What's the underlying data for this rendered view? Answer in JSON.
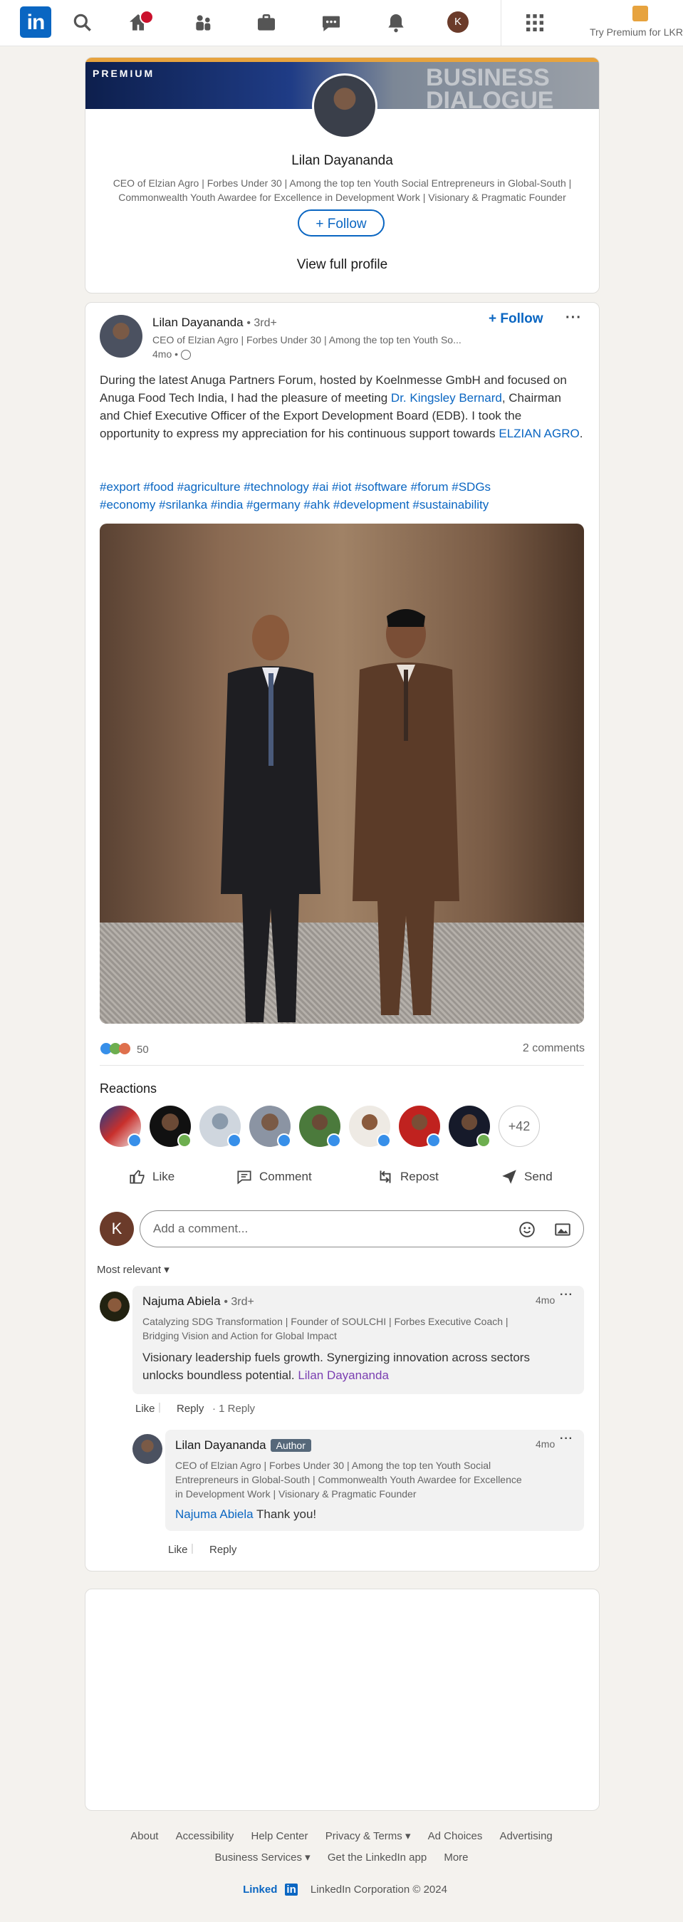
{
  "nav": {
    "logo": "in",
    "home_badge": "",
    "me_initial": "K",
    "premium_link": "Try Premium for LKR"
  },
  "profile_card": {
    "premium_label": "PREMIUM",
    "banner_text_1": "BUSINESS",
    "banner_text_2": "DIALOGUE",
    "name": "Lilan Dayananda",
    "headline": "CEO of Elzian Agro | Forbes Under 30 | Among the top ten Youth Social Entrepreneurs in Global-South | Commonwealth Youth Awardee for Excellence in Development Work | Visionary & Pragmatic Founder",
    "follow_label": "Follow",
    "view_profile_label": "View full profile"
  },
  "post": {
    "author": "Lilan Dayananda",
    "degree": "• 3rd+",
    "headline": "CEO of Elzian Agro | Forbes Under 30 | Among the top ten Youth So...",
    "time": "4mo •",
    "follow_label": "Follow",
    "text_1": "During the latest Anuga Partners Forum, hosted by Koelnmesse GmbH and focused on Anuga Food Tech India, I had the pleasure of meeting ",
    "mention_1": "Dr. Kingsley Bernard",
    "text_2": ", Chairman and Chief Executive Officer of the Export Development Board (EDB). I took the opportunity to express my appreciation for his continuous support towards ",
    "mention_2": "ELZIAN AGRO",
    "text_3": ".",
    "hashtags_line_1": "#export #food #agriculture #technology #ai #iot #software #forum #SDGs",
    "hashtags_line_2": "#economy #srilanka #india #germany #ahk #development #sustainability",
    "reaction_count": "50",
    "comments_count": "2 comments",
    "reactions_title": "Reactions",
    "more_reactors": "+42",
    "actions": {
      "like": "Like",
      "comment": "Comment",
      "repost": "Repost",
      "send": "Send"
    },
    "comment_placeholder": "Add a comment...",
    "sort_label": "Most relevant"
  },
  "comments": [
    {
      "name": "Najuma Abiela",
      "degree": "• 3rd+",
      "headline": "Catalyzing SDG Transformation | Founder of SOULCHI | Forbes Executive Coach | Bridging Vision and Action for Global Impact",
      "time": "4mo",
      "text": "Visionary leadership fuels growth. Synergizing innovation across sectors unlocks boundless potential. ",
      "mention": "Lilan Dayananda",
      "like": "Like",
      "reply": "Reply",
      "replies": "· 1 Reply"
    },
    {
      "name": "Lilan Dayananda",
      "badge": "Author",
      "headline": "CEO of Elzian Agro | Forbes Under 30 | Among the top ten Youth Social Entrepreneurs in Global-South | Commonwealth Youth Awardee for Excellence in Development Work | Visionary & Pragmatic Founder",
      "time": "4mo",
      "mention": "Najuma Abiela",
      "text": " Thank you!",
      "like": "Like",
      "reply": "Reply"
    }
  ],
  "footer": {
    "row1": [
      "About",
      "Accessibility",
      "Help Center",
      "Privacy & Terms ▾",
      "Ad Choices",
      "Advertising"
    ],
    "row2": [
      "Business Services ▾",
      "Get the LinkedIn app",
      "More"
    ],
    "brand": "Linked",
    "brand_in": "in",
    "copyright": "LinkedIn Corporation © 2024"
  },
  "colors": {
    "brand": "#0a66c2",
    "premium_gold": "#e7a33e",
    "page_bg": "#f4f2ee"
  }
}
